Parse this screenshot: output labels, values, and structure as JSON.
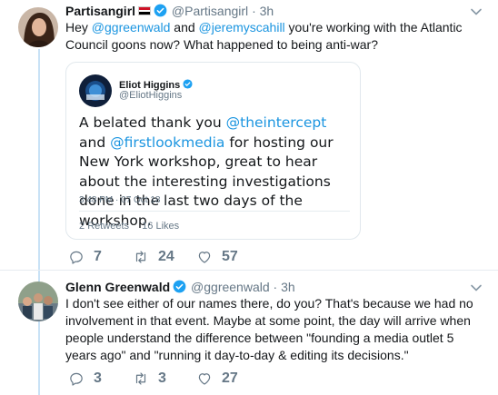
{
  "tweet1": {
    "name": "Partisangirl",
    "handle": "@Partisangirl",
    "dot": "·",
    "time": "3h",
    "text_parts": [
      "Hey ",
      "@ggreenwald",
      " and ",
      "@jeremyscahill",
      " you're working with the Atlantic Council goons now? What happened to being anti-war?"
    ],
    "replies": "7",
    "retweets": "24",
    "likes": "57",
    "quote": {
      "name": "Eliot Higgins",
      "handle": "@EliotHiggins",
      "text_parts": [
        "A belated thank you ",
        "@theintercept",
        " and ",
        "@firstlookmedia",
        " for hosting our New York workshop, great to hear about the interesting investigations done in the last two days of the workshop."
      ],
      "timestamp": "3:48 PM · 07 Oct 18",
      "retweets_count": "2",
      "retweets_label": "Retweets",
      "likes_count": "16",
      "likes_label": "Likes"
    }
  },
  "tweet2": {
    "name": "Glenn Greenwald",
    "handle": "@ggreenwald",
    "dot": "·",
    "time": "3h",
    "text": "I don't see either of our names there, do you? That's because we had no involvement in that event. Maybe at some point, the day will arrive when people understand the difference between \"founding a media outlet 5 years ago\" and \"running it day-to-day & editing its decisions.\"",
    "replies": "3",
    "retweets": "3",
    "likes": "27"
  },
  "colors": {
    "link": "#1b95e0",
    "verified": "#1da1f2",
    "thread_line": "#c9e2f6",
    "muted": "#657786"
  }
}
